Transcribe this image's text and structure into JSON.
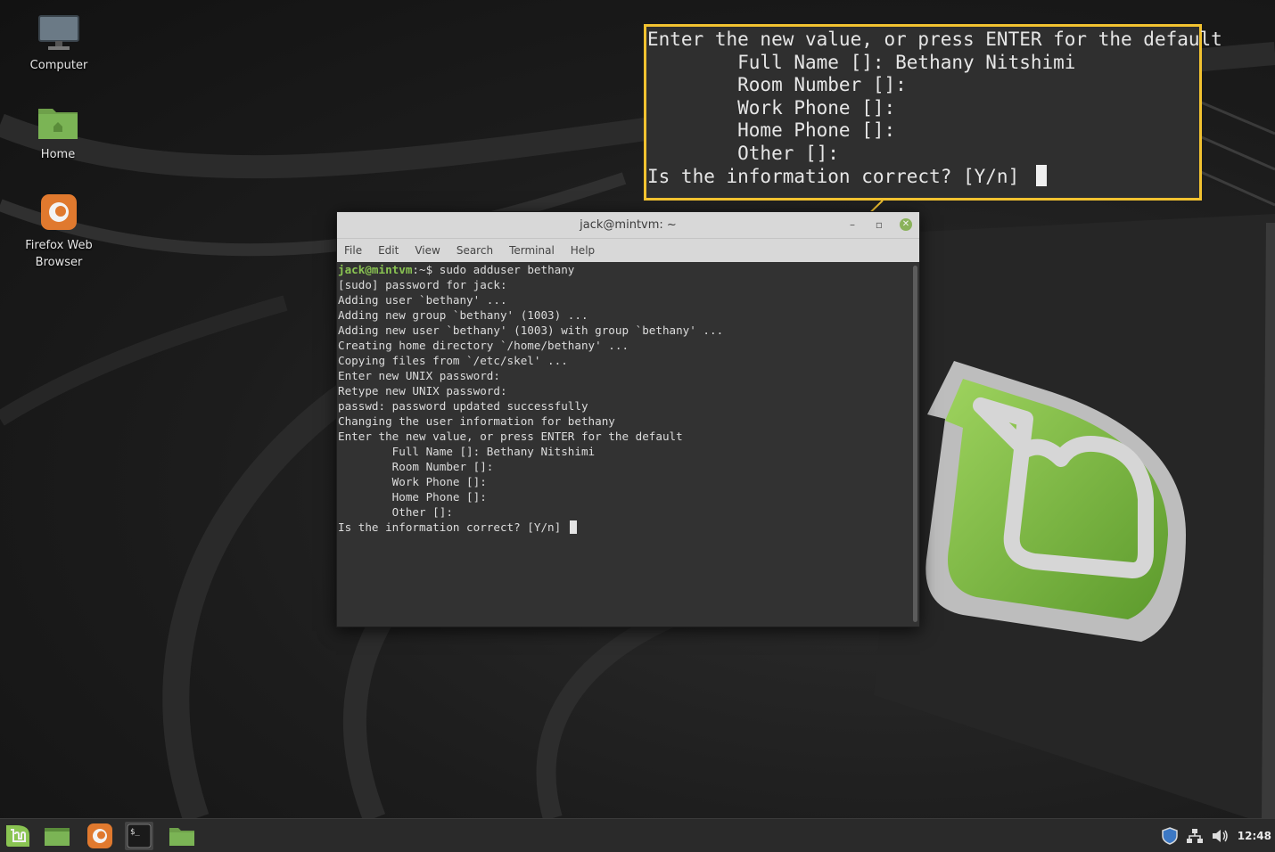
{
  "desktop": {
    "icons": [
      {
        "label": "Computer",
        "icon": "monitor-icon"
      },
      {
        "label": "Home",
        "icon": "folder-home-icon"
      },
      {
        "label": "Firefox Web Browser",
        "icon": "firefox-icon"
      }
    ]
  },
  "terminal": {
    "title": "jack@mintvm: ~",
    "menu": [
      "File",
      "Edit",
      "View",
      "Search",
      "Terminal",
      "Help"
    ],
    "prompt_user": "jack@mintvm",
    "prompt_path": ":~$ ",
    "command": "sudo adduser bethany",
    "output": [
      "[sudo] password for jack:",
      "Adding user `bethany' ...",
      "Adding new group `bethany' (1003) ...",
      "Adding new user `bethany' (1003) with group `bethany' ...",
      "Creating home directory `/home/bethany' ...",
      "Copying files from `/etc/skel' ...",
      "Enter new UNIX password:",
      "Retype new UNIX password:",
      "passwd: password updated successfully",
      "Changing the user information for bethany",
      "Enter the new value, or press ENTER for the default",
      "        Full Name []: Bethany Nitshimi",
      "        Room Number []:",
      "        Work Phone []:",
      "        Home Phone []:",
      "        Other []:",
      "Is the information correct? [Y/n] "
    ]
  },
  "callout": {
    "lines": [
      "Enter the new value, or press ENTER for the default",
      "        Full Name []: Bethany Nitshimi",
      "        Room Number []:",
      "        Work Phone []:",
      "        Home Phone []:",
      "        Other []:",
      "Is the information correct? [Y/n] "
    ],
    "border_color": "#f2c230"
  },
  "taskbar": {
    "clock": "12:48",
    "buttons": [
      "mint-menu-icon",
      "show-desktop-icon",
      "firefox-icon",
      "terminal-icon",
      "files-icon"
    ],
    "tray": [
      "shield-update-icon",
      "network-icon",
      "volume-icon"
    ]
  },
  "colors": {
    "accent": "#8ac452",
    "callout": "#f2c230",
    "terminal_bg": "#323232"
  }
}
